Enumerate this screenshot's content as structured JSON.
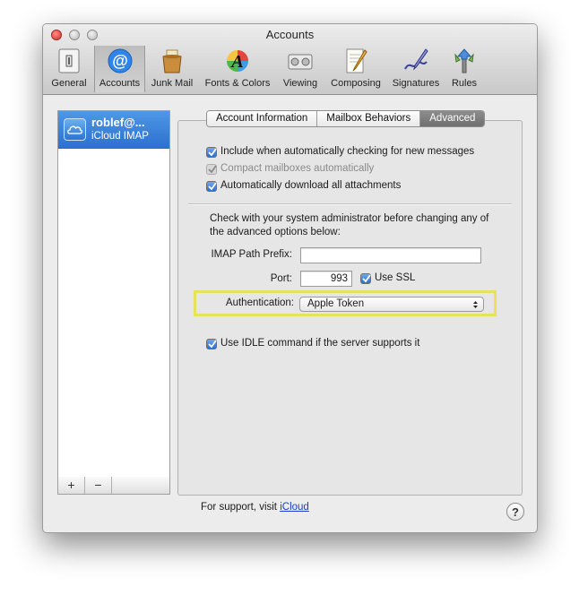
{
  "window": {
    "title": "Accounts"
  },
  "toolbar": {
    "items": [
      {
        "label": "General",
        "icon": "general-icon"
      },
      {
        "label": "Accounts",
        "icon": "at-sign-icon",
        "selected": true
      },
      {
        "label": "Junk Mail",
        "icon": "junk-mail-icon"
      },
      {
        "label": "Fonts & Colors",
        "icon": "fonts-colors-icon"
      },
      {
        "label": "Viewing",
        "icon": "viewing-icon"
      },
      {
        "label": "Composing",
        "icon": "composing-icon"
      },
      {
        "label": "Signatures",
        "icon": "signatures-icon"
      },
      {
        "label": "Rules",
        "icon": "rules-icon"
      }
    ]
  },
  "accounts": [
    {
      "name": "roblef@...",
      "type": "iCloud IMAP",
      "icon": "cloud-icon"
    }
  ],
  "list_buttons": {
    "add": "+",
    "remove": "−"
  },
  "tabs": [
    {
      "label": "Account Information",
      "active": false
    },
    {
      "label": "Mailbox Behaviors",
      "active": false
    },
    {
      "label": "Advanced",
      "active": true
    }
  ],
  "advanced": {
    "include_check": {
      "label": "Include when automatically checking for new messages",
      "checked": true
    },
    "compact_check": {
      "label": "Compact mailboxes automatically",
      "checked": true,
      "disabled": true
    },
    "download_check": {
      "label": "Automatically download all attachments",
      "checked": true
    },
    "notice": "Check with your system administrator before changing any of the advanced options below:",
    "imap_prefix": {
      "label": "IMAP Path Prefix:",
      "value": ""
    },
    "port": {
      "label": "Port:",
      "value": "993"
    },
    "ssl": {
      "label": "Use SSL",
      "checked": true
    },
    "authentication": {
      "label": "Authentication:",
      "value": "Apple Token"
    },
    "idle_check": {
      "label": "Use IDLE command if the server supports it",
      "checked": true
    }
  },
  "support": {
    "text": "For support, visit",
    "link": "iCloud"
  },
  "help": {
    "label": "?"
  },
  "colors": {
    "selection": "#2b70cf",
    "highlight": "#e8e25a"
  }
}
